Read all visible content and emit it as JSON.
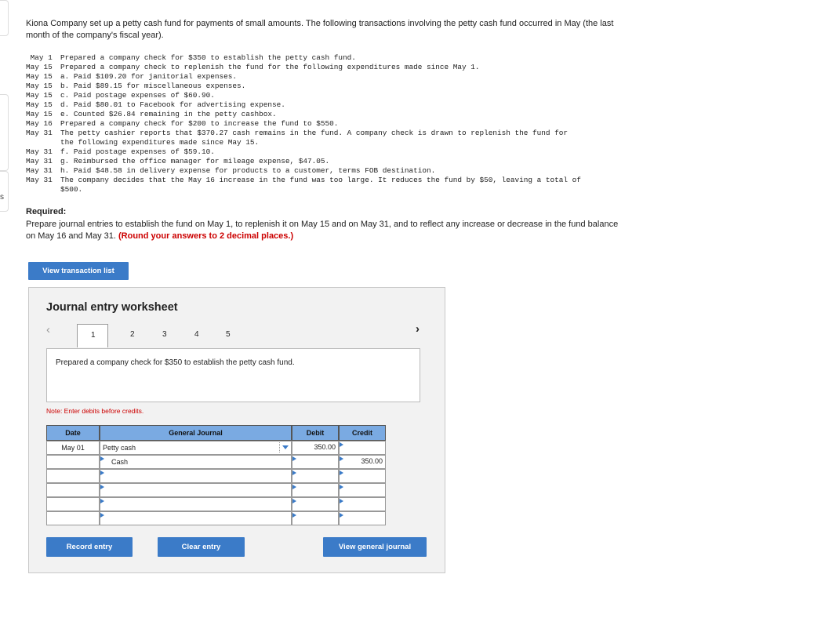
{
  "intro": "Kiona Company set up a petty cash fund for payments of small amounts. The following transactions involving the petty cash fund occurred in May (the last month of the company's fiscal year).",
  "transactions": [
    {
      "date": " May 1",
      "text": "Prepared a company check for $350 to establish the petty cash fund."
    },
    {
      "date": "May 15",
      "text": "Prepared a company check to replenish the fund for the following expenditures made since May 1."
    },
    {
      "date": "May 15",
      "text": "a. Paid $109.20 for janitorial expenses."
    },
    {
      "date": "May 15",
      "text": "b. Paid $89.15 for miscellaneous expenses."
    },
    {
      "date": "May 15",
      "text": "c. Paid postage expenses of $60.90."
    },
    {
      "date": "May 15",
      "text": "d. Paid $80.01 to Facebook for advertising expense."
    },
    {
      "date": "May 15",
      "text": "e. Counted $26.84 remaining in the petty cashbox."
    },
    {
      "date": "May 16",
      "text": "Prepared a company check for $200 to increase the fund to $550."
    },
    {
      "date": "May 31",
      "text": "The petty cashier reports that $370.27 cash remains in the fund. A company check is drawn to replenish the fund for\nthe following expenditures made since May 15."
    },
    {
      "date": "May 31",
      "text": "f. Paid postage expenses of $59.10."
    },
    {
      "date": "May 31",
      "text": "g. Reimbursed the office manager for mileage expense, $47.05."
    },
    {
      "date": "May 31",
      "text": "h. Paid $48.58 in delivery expense for products to a customer, terms FOB destination."
    },
    {
      "date": "May 31",
      "text": "The company decides that the May 16 increase in the fund was too large. It reduces the fund by $50, leaving a total of\n$500."
    }
  ],
  "required": {
    "heading": "Required:",
    "text": "Prepare journal entries to establish the fund on May 1, to replenish it on May 15 and on May 31, and to reflect any increase or decrease in the fund balance on May 16 and May 31. ",
    "emphasis": "(Round your answers to 2 decimal places.)"
  },
  "view_transaction_list": "View transaction list",
  "worksheet": {
    "title": "Journal entry worksheet",
    "pages": [
      "1",
      "2",
      "3",
      "4",
      "5"
    ],
    "active_page": "1",
    "description": "Prepared a company check for $350 to establish the petty cash fund.",
    "note": "Note: Enter debits before credits.",
    "headers": {
      "date": "Date",
      "journal": "General Journal",
      "debit": "Debit",
      "credit": "Credit"
    },
    "rows": [
      {
        "date": "May 01",
        "account": "Petty cash",
        "debit": "350.00",
        "credit": ""
      },
      {
        "date": "",
        "account": "Cash",
        "debit": "",
        "credit": "350.00"
      },
      {
        "date": "",
        "account": "",
        "debit": "",
        "credit": ""
      },
      {
        "date": "",
        "account": "",
        "debit": "",
        "credit": ""
      },
      {
        "date": "",
        "account": "",
        "debit": "",
        "credit": ""
      },
      {
        "date": "",
        "account": "",
        "debit": "",
        "credit": ""
      }
    ],
    "record_entry": "Record entry",
    "clear_entry": "Clear entry",
    "view_general_journal": "View general journal"
  },
  "edge_letter": "s",
  "colors": {
    "accent": "#3b7bc8",
    "header": "#7aaae2",
    "emphasis": "#cc0000"
  },
  "icons": {
    "prev": "chevron-left-icon",
    "next": "chevron-right-icon",
    "dropdown": "dropdown-arrow-icon"
  }
}
